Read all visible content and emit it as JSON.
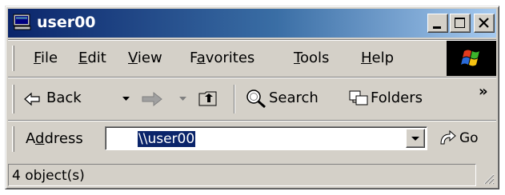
{
  "window": {
    "title": "user00",
    "app_icon": "computer-icon"
  },
  "caption_buttons": [
    {
      "name": "minimize",
      "icon": "minimize-icon"
    },
    {
      "name": "maximize",
      "icon": "maximize-icon"
    },
    {
      "name": "close",
      "icon": "close-icon"
    }
  ],
  "menu": {
    "items": [
      {
        "label_pre": "",
        "label_u": "F",
        "label_post": "ile"
      },
      {
        "label_pre": "",
        "label_u": "E",
        "label_post": "dit"
      },
      {
        "label_pre": "",
        "label_u": "V",
        "label_post": "iew"
      },
      {
        "label_pre": "F",
        "label_u": "a",
        "label_post": "vorites"
      },
      {
        "label_pre": "",
        "label_u": "T",
        "label_post": "ools"
      },
      {
        "label_pre": "",
        "label_u": "H",
        "label_post": "elp"
      }
    ],
    "logo": "windows-flag-icon"
  },
  "toolbar": {
    "back_label": "Back",
    "search_label": "Search",
    "folders_label": "Folders",
    "overflow": "»"
  },
  "address": {
    "label_pre": "A",
    "label_u": "d",
    "label_post": "dress",
    "value": "\\\\user00",
    "go_label": "Go"
  },
  "status": {
    "text": "4 object(s)"
  },
  "colors": {
    "title_start": "#0a246a",
    "title_end": "#a6caf0",
    "face": "#d4d0c8",
    "selection": "#0a246a"
  }
}
